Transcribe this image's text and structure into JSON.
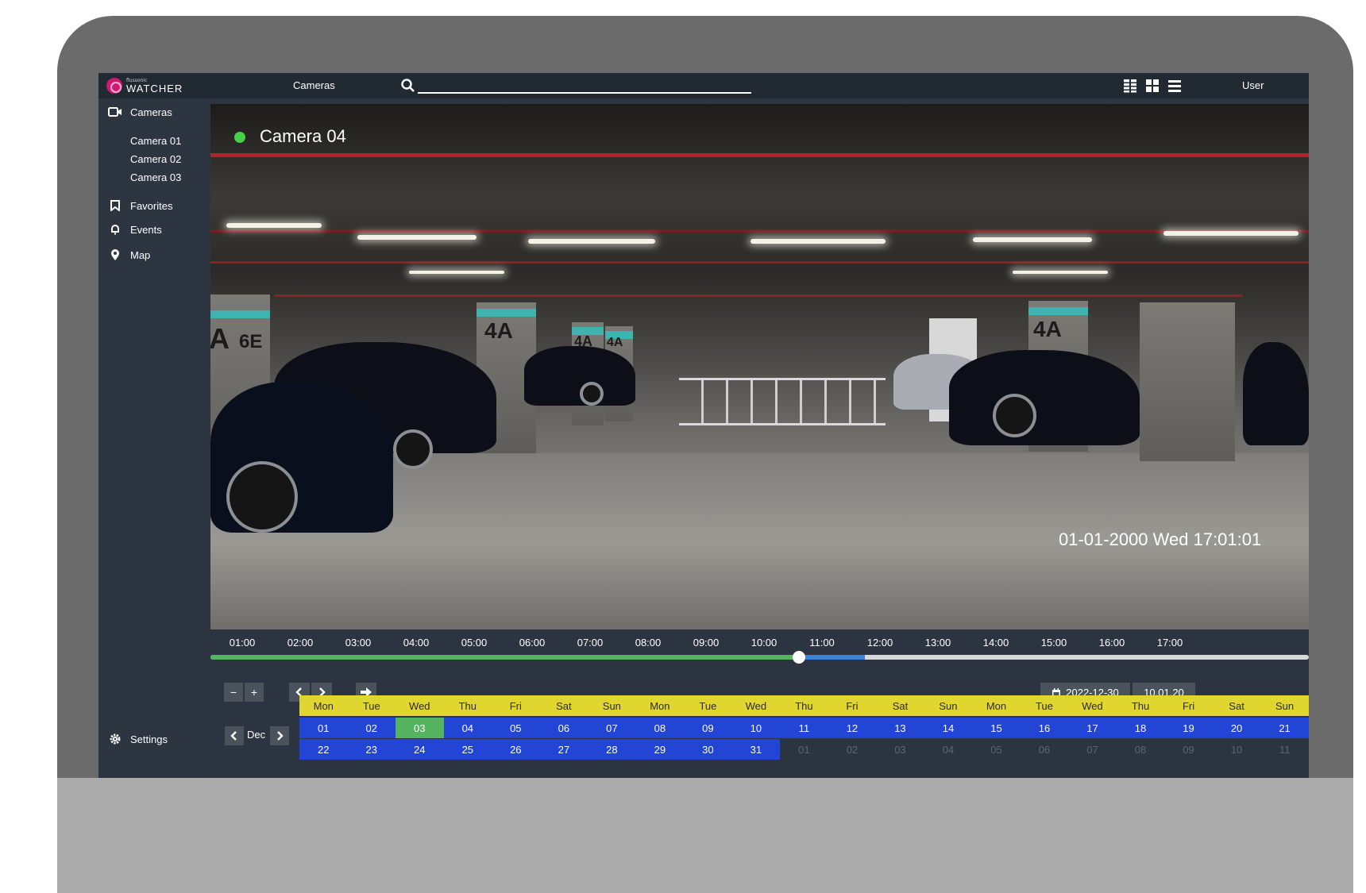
{
  "brand": {
    "small": "flussonic",
    "name": "WATCHER"
  },
  "topbar": {
    "section": "Cameras",
    "search_placeholder": "",
    "user": "User"
  },
  "sidebar": {
    "cameras_label": "Cameras",
    "cameras": [
      "Camera 01",
      "Camera 02",
      "Camera 03"
    ],
    "favorites_label": "Favorites",
    "events_label": "Events",
    "map_label": "Map",
    "settings_label": "Settings"
  },
  "player": {
    "camera_name": "Camera 04",
    "status_color": "#44d04a",
    "timestamp": "01-01-2000 Wed 17:01:01"
  },
  "timeline": {
    "labels": [
      "01:00",
      "02:00",
      "03:00",
      "04:00",
      "05:00",
      "06:00",
      "07:00",
      "08:00",
      "09:00",
      "10:00",
      "11:00",
      "12:00",
      "13:00",
      "14:00",
      "15:00",
      "16:00",
      "17:00"
    ],
    "recorded_until_fraction": 0.536,
    "playhead_fraction": 0.536,
    "blue_end_fraction": 0.596
  },
  "controls": {
    "zoom_out": "−",
    "zoom_in": "+",
    "prev": "‹",
    "next": "›",
    "date": "2022-12-30",
    "time": "10.01.20"
  },
  "calendar": {
    "month": "Dec",
    "weekdays": [
      "Mon",
      "Tue",
      "Wed",
      "Thu",
      "Fri",
      "Sat",
      "Sun",
      "Mon",
      "Tue",
      "Wed",
      "Thu",
      "Fri",
      "Sat",
      "Sun",
      "Mon",
      "Tue",
      "Wed",
      "Thu",
      "Fri",
      "Sat",
      "Sun"
    ],
    "row1": [
      "01",
      "02",
      "03",
      "04",
      "05",
      "06",
      "07",
      "08",
      "09",
      "10",
      "11",
      "12",
      "13",
      "14",
      "15",
      "16",
      "17",
      "18",
      "19",
      "20",
      "21"
    ],
    "row2": [
      "22",
      "23",
      "24",
      "25",
      "26",
      "27",
      "28",
      "29",
      "30",
      "31",
      "01",
      "02",
      "03",
      "04",
      "05",
      "06",
      "07",
      "08",
      "09",
      "10",
      "11"
    ],
    "selected_day_index": 2,
    "row2_active_count": 10
  },
  "colors": {
    "accent_green": "#54b45f",
    "day_blue": "#2245d6",
    "weekday_yellow": "#e1d530",
    "brand_pink": "#d3176e"
  }
}
